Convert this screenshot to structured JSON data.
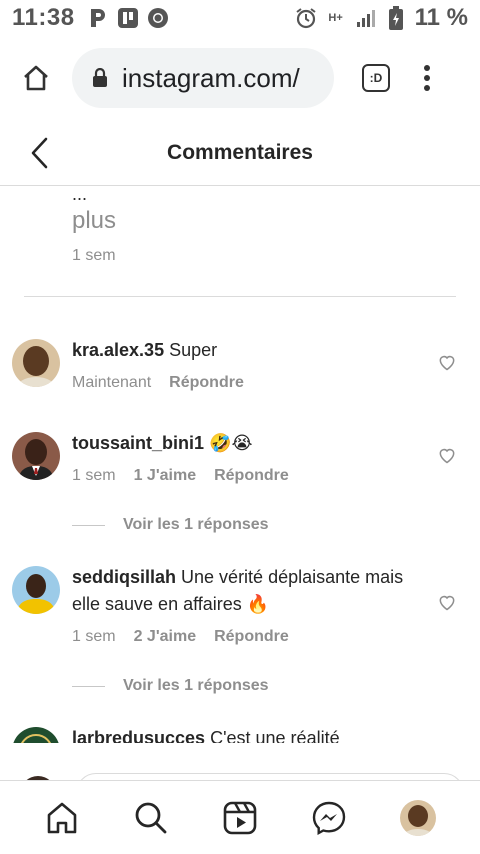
{
  "status_bar": {
    "time": "11:38",
    "battery": "11 %",
    "network": "H+"
  },
  "browser": {
    "url": "instagram.com/",
    "tabs_label": ":D"
  },
  "header": {
    "title": "Commentaires"
  },
  "caption": {
    "ellipsis": "...",
    "more": "plus",
    "time": "1 sem"
  },
  "comments": [
    {
      "username": "kra.alex.35",
      "text": " Super",
      "time": "Maintenant",
      "likes": "",
      "reply": "Répondre",
      "avatar_colors": [
        "#d6b48c",
        "#5a3a22"
      ]
    },
    {
      "username": "toussaint_bini1",
      "text": " 🤣😭",
      "time": "1 sem",
      "likes": "1 J'aime",
      "reply": "Répondre",
      "replies_label": "Voir les 1 réponses",
      "avatar_colors": [
        "#7a4a3a",
        "#2a1a14"
      ]
    },
    {
      "username": "seddiqsillah",
      "text": " Une vérité déplaisante mais elle sauve en affaires 🔥",
      "time": "1 sem",
      "likes": "2 J'aime",
      "reply": "Répondre",
      "replies_label": "Voir les 1 réponses",
      "avatar_colors": [
        "#87c3e8",
        "#f2c200"
      ]
    },
    {
      "username": "larbredusucces",
      "text": " C'est une réalité",
      "avatar_colors": [
        "#1f4d2e",
        "#e0c060"
      ]
    }
  ],
  "colors": {
    "text": "#262626",
    "secondary": "#8e8e8e",
    "divider": "#dbdbdb"
  }
}
